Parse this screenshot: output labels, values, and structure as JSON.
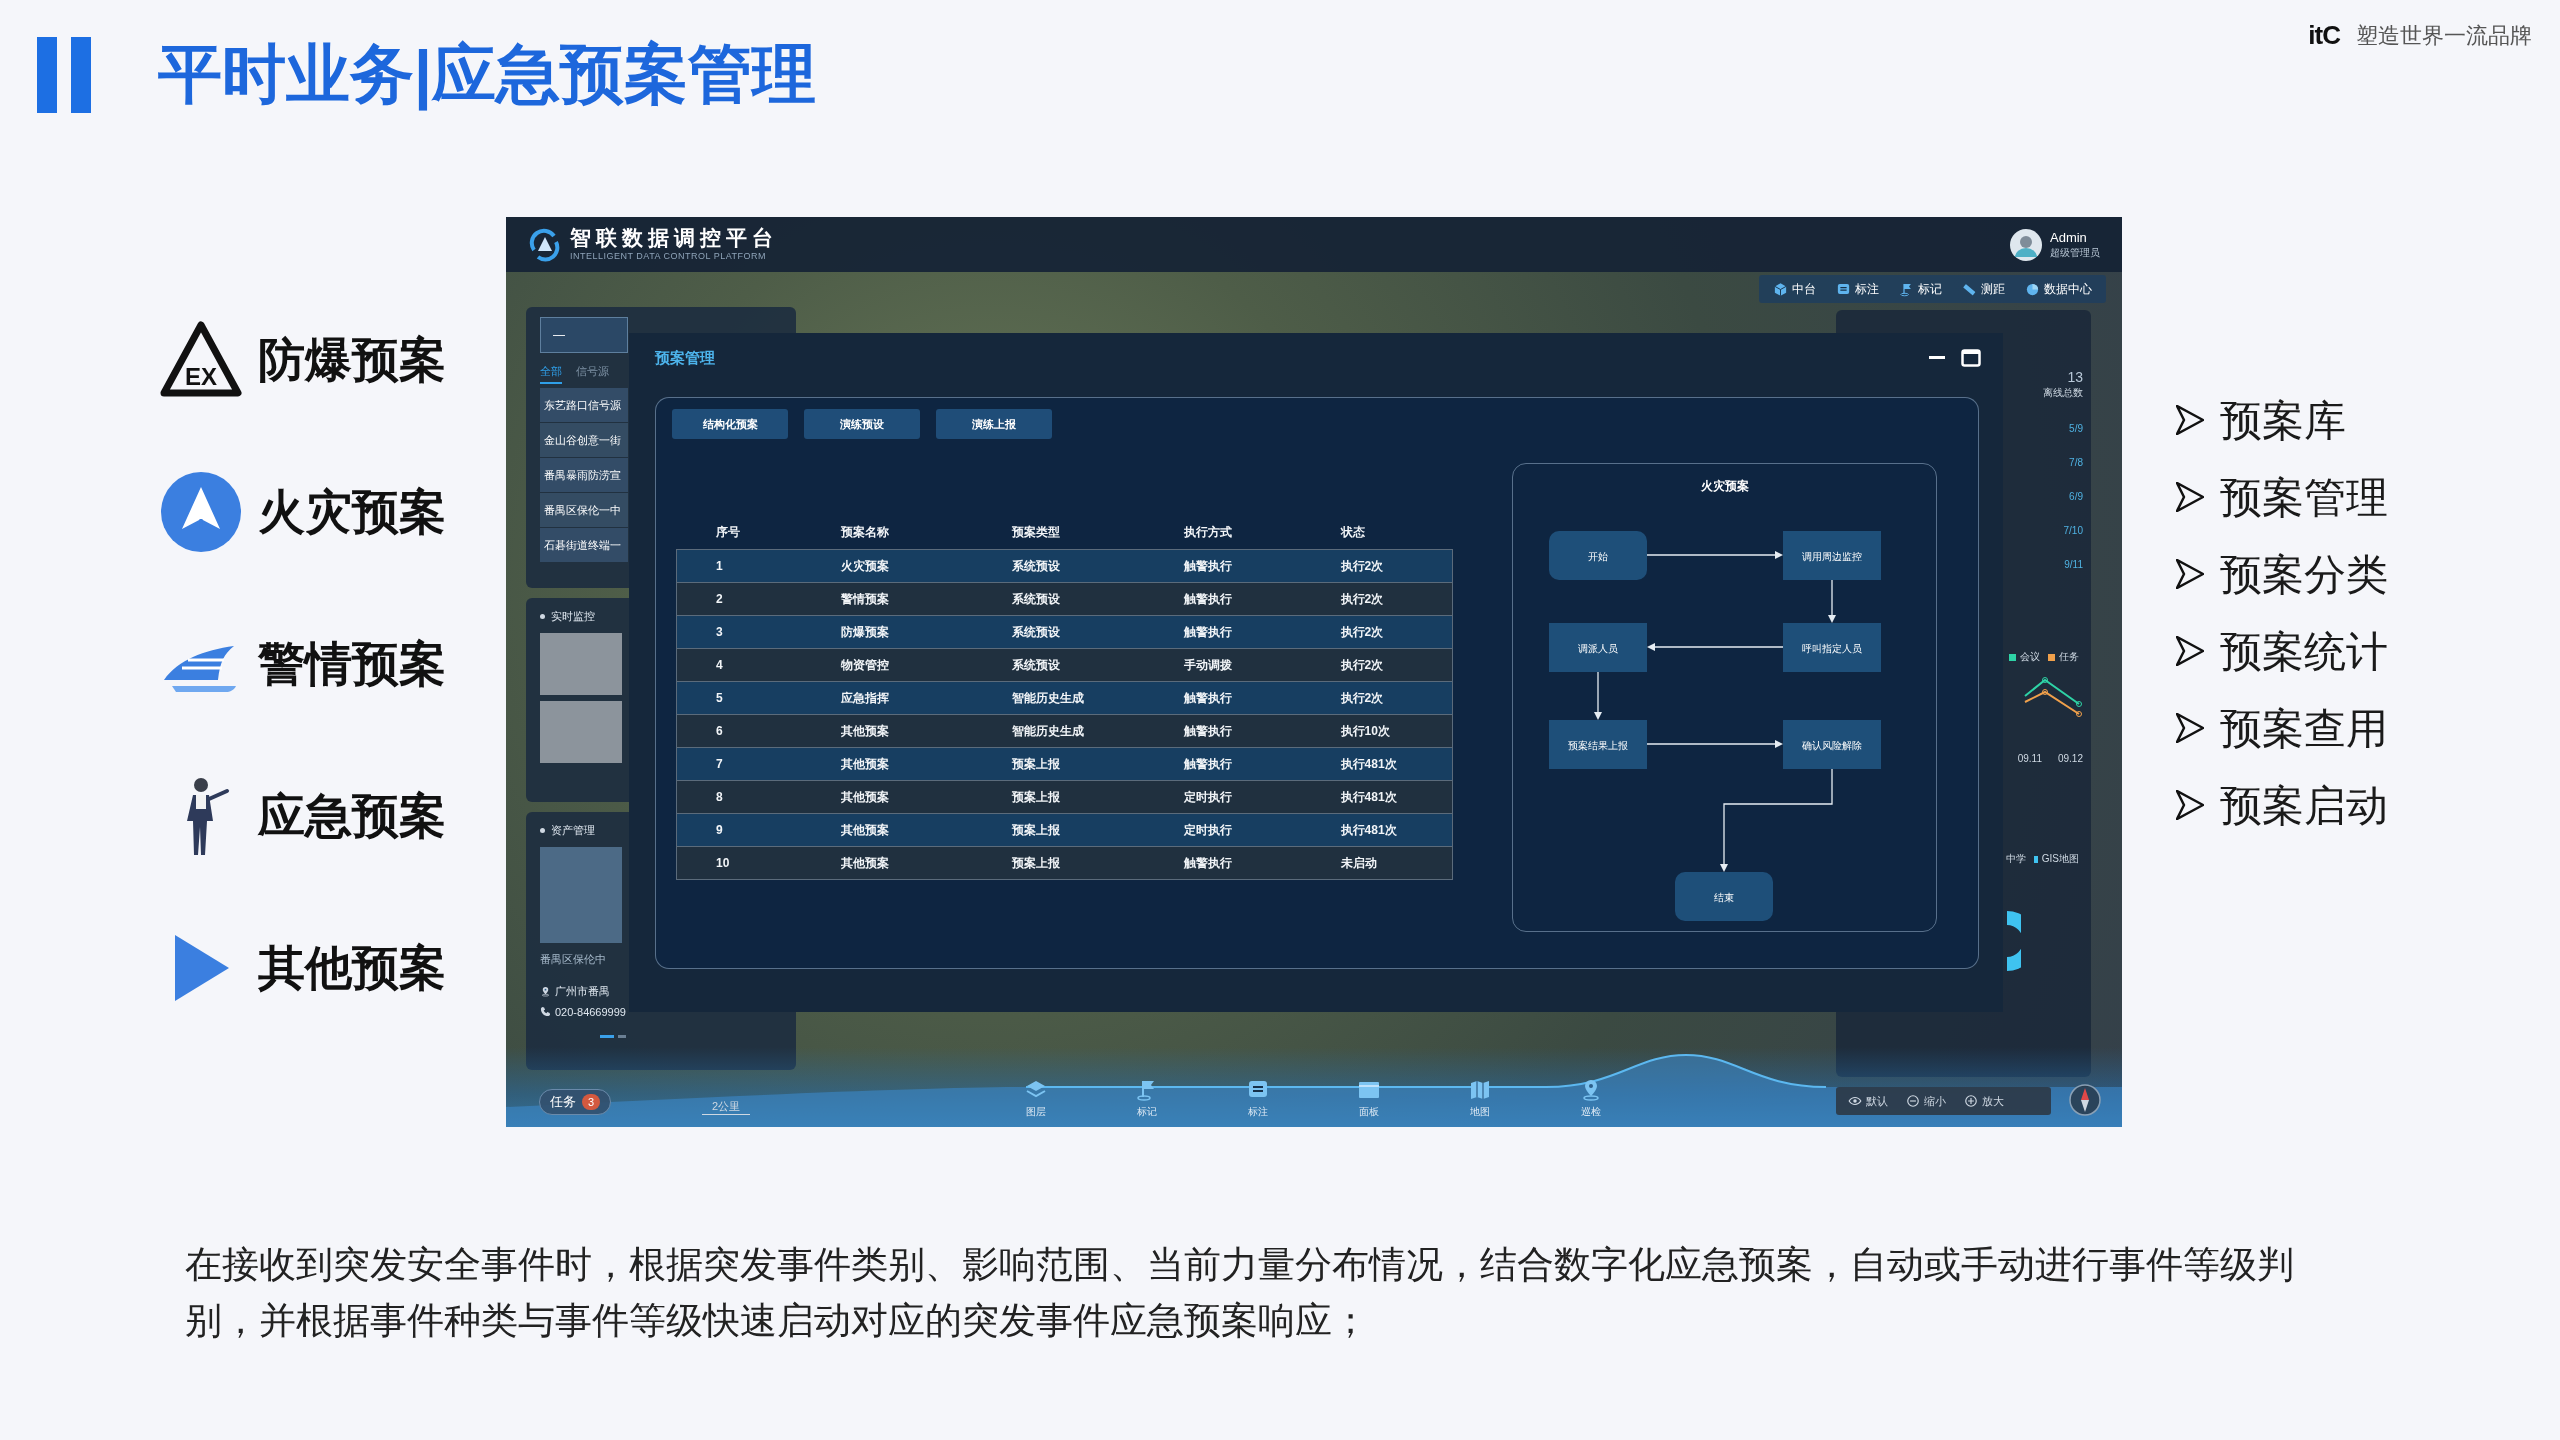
{
  "slide": {
    "title": "平时业务|应急预案管理",
    "brand": {
      "logo": "itC",
      "slogan": "塑造世界一流品牌"
    }
  },
  "plan_types": [
    {
      "kind": "ex",
      "label": "防爆预案",
      "badge_text": "EX"
    },
    {
      "kind": "fire",
      "label": "火灾预案"
    },
    {
      "kind": "boat",
      "label": "警情预案"
    },
    {
      "kind": "person",
      "label": "应急预案"
    },
    {
      "kind": "play",
      "label": "其他预案"
    }
  ],
  "app": {
    "header": {
      "title": "智联数据调控平台",
      "subtitle": "INTELLIGENT DATA CONTROL PLATFORM",
      "user": {
        "name": "Admin",
        "role": "超级管理员"
      }
    },
    "toolbar": [
      {
        "kind": "cube",
        "label": "中台"
      },
      {
        "kind": "note",
        "label": "标注"
      },
      {
        "kind": "flag",
        "label": "标记"
      },
      {
        "kind": "ruler",
        "label": "测距"
      },
      {
        "kind": "pie",
        "label": "数据中心"
      }
    ],
    "left_panel": {
      "search_value": "—",
      "tabs": [
        {
          "label": "全部",
          "selected": true
        },
        {
          "label": "信号源",
          "selected": false
        }
      ],
      "items": [
        "东艺路口信号源",
        "金山谷创意一街",
        "番禺暴雨防涝宣",
        "番禺区保伦一中",
        "石碁街道终端一"
      ],
      "monitor_title": "实时监控",
      "asset": {
        "title": "资产管理",
        "name": "番禺区保伦中",
        "address": "广州市番禺",
        "phone": "020-84669999"
      }
    },
    "modal": {
      "title": "预案管理",
      "buttons": [
        "结构化预案",
        "演练预设",
        "演练上报"
      ],
      "table": {
        "columns": [
          "序号",
          "预案名称",
          "预案类型",
          "执行方式",
          "状态"
        ],
        "rows": [
          [
            "1",
            "火灾预案",
            "系统预设",
            "触警执行",
            "执行2次"
          ],
          [
            "2",
            "警情预案",
            "系统预设",
            "触警执行",
            "执行2次"
          ],
          [
            "3",
            "防爆预案",
            "系统预设",
            "触警执行",
            "执行2次"
          ],
          [
            "4",
            "物资管控",
            "系统预设",
            "手动调拨",
            "执行2次"
          ],
          [
            "5",
            "应急指挥",
            "智能历史生成",
            "触警执行",
            "执行2次"
          ],
          [
            "6",
            "其他预案",
            "智能历史生成",
            "触警执行",
            "执行10次"
          ],
          [
            "7",
            "其他预案",
            "预案上报",
            "触警执行",
            "执行481次"
          ],
          [
            "8",
            "其他预案",
            "预案上报",
            "定时执行",
            "执行481次"
          ],
          [
            "9",
            "其他预案",
            "预案上报",
            "定时执行",
            "执行481次"
          ],
          [
            "10",
            "其他预案",
            "预案上报",
            "触警执行",
            "未启动"
          ]
        ]
      },
      "flow": {
        "title": "火灾预案",
        "nodes": [
          {
            "kind": "terminal",
            "label": "开始"
          },
          {
            "kind": "process",
            "label": "调用周边监控"
          },
          {
            "kind": "process",
            "label": "调派人员"
          },
          {
            "kind": "process",
            "label": "呼叫指定人员"
          },
          {
            "kind": "process",
            "label": "预案结果上报"
          },
          {
            "kind": "process",
            "label": "确认风险解除"
          },
          {
            "kind": "terminal",
            "label": "结束"
          }
        ]
      }
    },
    "right_panel": {
      "total": "13",
      "total_label": "离线总数",
      "ratios": [
        "5/9",
        "7/8",
        "6/9",
        "7/10",
        "9/11"
      ],
      "legend": [
        {
          "label": "会议",
          "color": "#2ed3a6"
        },
        {
          "label": "任务",
          "color": "#f0a04b"
        }
      ],
      "dates": [
        "09.11",
        "09.12"
      ],
      "pie_legend": [
        {
          "label": "中学"
        },
        {
          "label": "GIS地图",
          "color": "#3fc3f0"
        }
      ]
    },
    "bottom_bar": {
      "task": {
        "label": "任务",
        "count": "3"
      },
      "scale": "2公里",
      "tools": [
        {
          "kind": "layers",
          "label": "图层"
        },
        {
          "kind": "flag",
          "label": "标记"
        },
        {
          "kind": "note",
          "label": "标注"
        },
        {
          "kind": "panel",
          "label": "面板"
        },
        {
          "kind": "map",
          "label": "地图"
        },
        {
          "kind": "pin",
          "label": "巡检"
        }
      ],
      "view_controls": [
        {
          "kind": "eye",
          "label": "默认"
        },
        {
          "kind": "minus",
          "label": "缩小"
        },
        {
          "kind": "plus",
          "label": "放大"
        }
      ]
    }
  },
  "features": [
    "预案库",
    "预案管理",
    "预案分类",
    "预案统计",
    "预案查用",
    "预案启动"
  ],
  "description": "在接收到突发安全事件时，根据突发事件类别、影响范围、当前力量分布情况，结合数字化应急预案，自动或手动进行事件等级判别，并根据事件种类与事件等级快速启动对应的突发事件应急预案响应；"
}
